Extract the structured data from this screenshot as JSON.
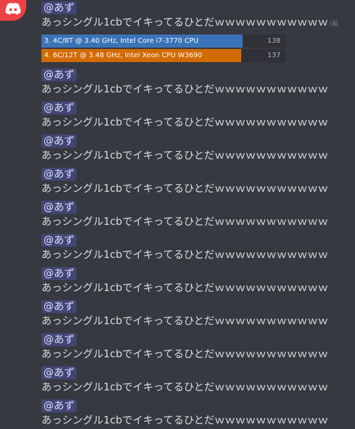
{
  "message": {
    "first_mention": "@あず",
    "first_text": "あっシングル1cbでイキってるひとだｗｗｗｗｗｗｗｗｗｗｗ",
    "edited_label": "(編",
    "colors": {
      "mention_bg": "#414675",
      "mention_text": "#dee0fc",
      "bar_blue": "#3b73b9",
      "bar_orange": "#d16b00"
    }
  },
  "benchmark": [
    {
      "label": "3. 4C/8T @ 3.40 GHz,  Intel Core i7-3770 CPU",
      "score": 138,
      "color": "#3b73b9"
    },
    {
      "label": "4. 6C/12T @ 3.48 GHz, Intel Xeon CPU W3690",
      "score": 137,
      "color": "#d16b00"
    }
  ],
  "repeats": [
    {
      "mention": "@あず",
      "text": "あっシングル1cbでイキってるひとだｗｗｗｗｗｗｗｗｗｗｗ"
    },
    {
      "mention": "@あず",
      "text": "あっシングル1cbでイキってるひとだｗｗｗｗｗｗｗｗｗｗｗ"
    },
    {
      "mention": "@あず",
      "text": "あっシングル1cbでイキってるひとだｗｗｗｗｗｗｗｗｗｗｗ"
    },
    {
      "mention": "@あず",
      "text": "あっシングル1cbでイキってるひとだｗｗｗｗｗｗｗｗｗｗｗ"
    },
    {
      "mention": "@あず",
      "text": "あっシングル1cbでイキってるひとだｗｗｗｗｗｗｗｗｗｗｗ"
    },
    {
      "mention": "@あず",
      "text": "あっシングル1cbでイキってるひとだｗｗｗｗｗｗｗｗｗｗｗ"
    },
    {
      "mention": "@あず",
      "text": "あっシングル1cbでイキってるひとだｗｗｗｗｗｗｗｗｗｗｗ"
    },
    {
      "mention": "@あず",
      "text": "あっシングル1cbでイキってるひとだｗｗｗｗｗｗｗｗｗｗｗ"
    },
    {
      "mention": "@あず",
      "text": "あっシングル1cbでイキってるひとだｗｗｗｗｗｗｗｗｗｗｗ"
    },
    {
      "mention": "@あず",
      "text": "あっシングル1cbでイキってるひとだｗｗｗｗｗｗｗｗｗｗｗ"
    },
    {
      "mention": "@あず",
      "text": "あっシングル1cbでイキってるひとだｗｗｗｗｗｗｗｗｗｗｗ"
    }
  ]
}
